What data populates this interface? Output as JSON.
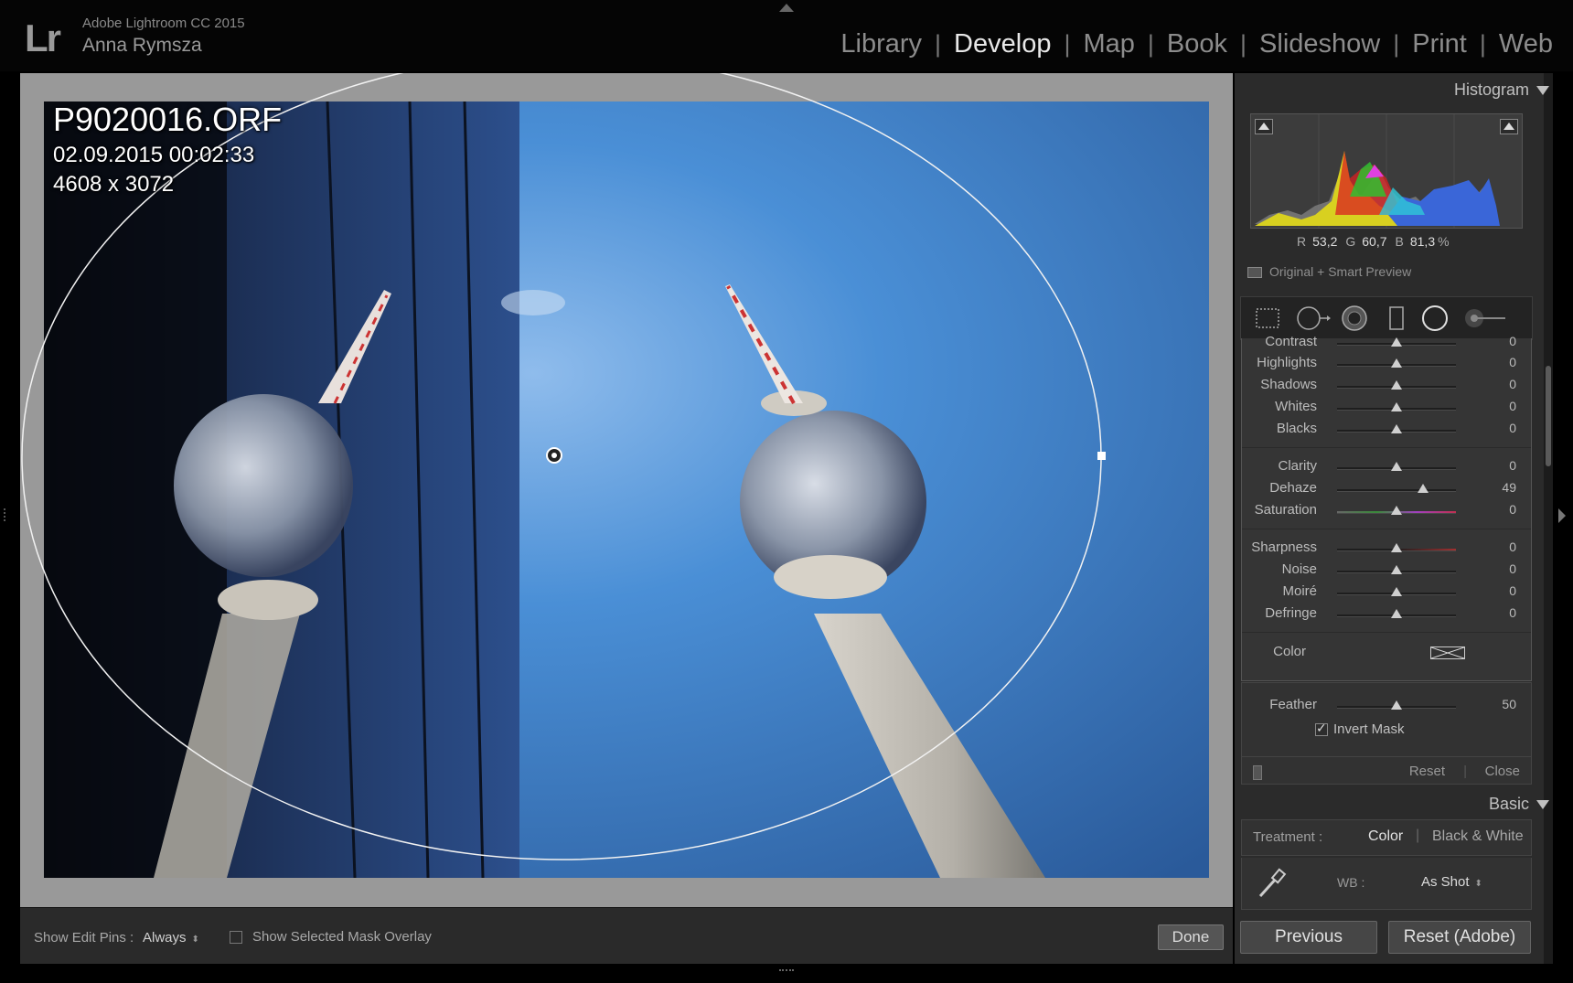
{
  "app": {
    "logo": "Lr",
    "name": "Adobe Lightroom CC 2015",
    "user": "Anna Rymsza"
  },
  "modules": [
    {
      "label": "Library",
      "active": false
    },
    {
      "label": "Develop",
      "active": true
    },
    {
      "label": "Map",
      "active": false
    },
    {
      "label": "Book",
      "active": false
    },
    {
      "label": "Slideshow",
      "active": false
    },
    {
      "label": "Print",
      "active": false
    },
    {
      "label": "Web",
      "active": false
    }
  ],
  "photo_info": {
    "filename": "P9020016.ORF",
    "datetime": "02.09.2015 00:02:33",
    "dimensions": "4608 x 3072"
  },
  "toolbar": {
    "edit_pins_label": "Show Edit Pins :",
    "edit_pins_value": "Always",
    "mask_overlay_label": "Show Selected Mask Overlay",
    "mask_overlay_checked": false,
    "done_label": "Done"
  },
  "histogram": {
    "title": "Histogram",
    "r_label": "R",
    "r_value": "53,2",
    "g_label": "G",
    "g_value": "60,7",
    "b_label": "B",
    "b_value": "81,3",
    "unit": "%",
    "preview_label": "Original + Smart Preview"
  },
  "tool_strip": [
    "crop-overlay-icon",
    "spot-removal-icon",
    "red-eye-icon",
    "graduated-filter-icon",
    "radial-filter-icon",
    "adjustment-brush-icon"
  ],
  "adjustments": {
    "group1": [
      {
        "label": "Contrast",
        "value": "0",
        "level": 0.5
      },
      {
        "label": "Highlights",
        "value": "0",
        "level": 0.5
      },
      {
        "label": "Shadows",
        "value": "0",
        "level": 0.5
      },
      {
        "label": "Whites",
        "value": "0",
        "level": 0.5
      },
      {
        "label": "Blacks",
        "value": "0",
        "level": 0.5
      }
    ],
    "group2": [
      {
        "label": "Clarity",
        "value": "0",
        "level": 0.5
      },
      {
        "label": "Dehaze",
        "value": "49",
        "level": 0.72
      },
      {
        "label": "Saturation",
        "value": "0",
        "level": 0.5
      }
    ],
    "group3": [
      {
        "label": "Sharpness",
        "value": "0",
        "level": 0.5
      },
      {
        "label": "Noise",
        "value": "0",
        "level": 0.5
      },
      {
        "label": "Moiré",
        "value": "0",
        "level": 0.5
      },
      {
        "label": "Defringe",
        "value": "0",
        "level": 0.5
      }
    ],
    "color_label": "Color"
  },
  "mask": {
    "feather_label": "Feather",
    "feather_value": "50",
    "feather_level": 0.5,
    "invert_label": "Invert Mask",
    "invert_checked": true,
    "reset_label": "Reset",
    "close_label": "Close"
  },
  "basic": {
    "title": "Basic",
    "treatment_label": "Treatment :",
    "treatment_color": "Color",
    "treatment_bw": "Black & White",
    "wb_label": "WB :",
    "wb_value": "As Shot"
  },
  "nav": {
    "previous_label": "Previous",
    "reset_label": "Reset (Adobe)"
  }
}
